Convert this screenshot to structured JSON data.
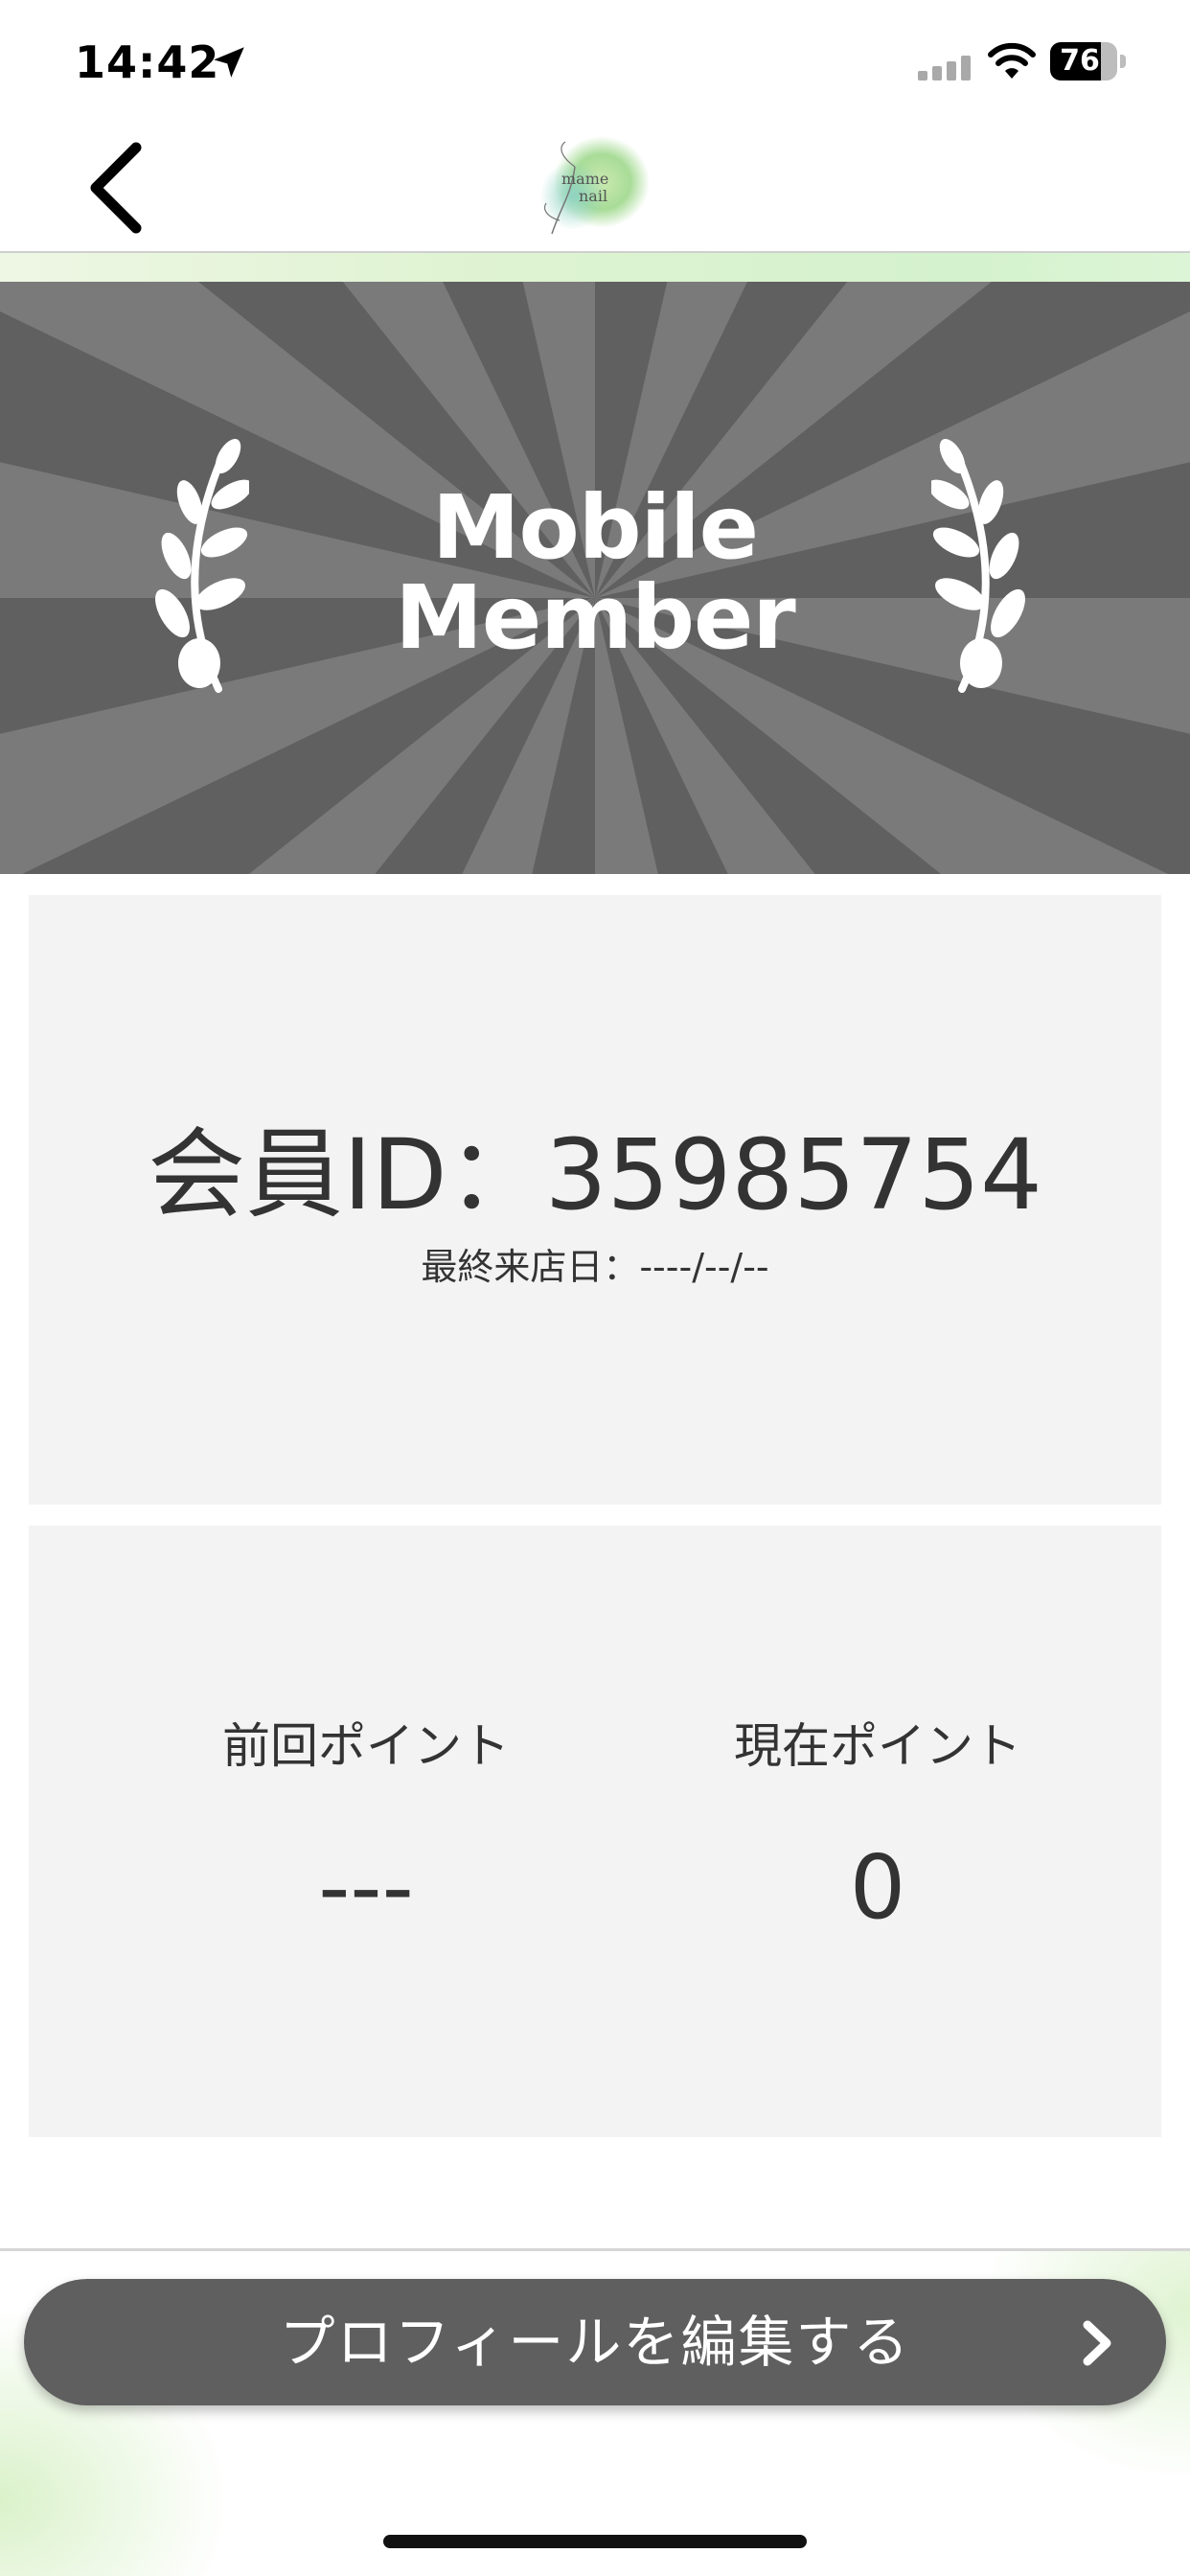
{
  "status_bar": {
    "time": "14:42",
    "battery_level": "76",
    "icons": [
      "location-arrow-icon",
      "cellular-signal-icon",
      "wifi-icon",
      "battery-icon"
    ]
  },
  "nav": {
    "back_icon": "chevron-left-icon",
    "logo_line1": "mame",
    "logo_line2": "nail"
  },
  "banner": {
    "title_line1": "Mobile",
    "title_line2": "Member",
    "icons": [
      "laurel-left-icon",
      "laurel-right-icon"
    ],
    "background_color": "#606060",
    "ray_color": "#7a7a7a"
  },
  "member_card": {
    "id_label": "会員ID：",
    "id_value": "35985754",
    "last_visit_label": "最終来店日：",
    "last_visit_value": "----/--/--"
  },
  "points": {
    "previous_label": "前回ポイント",
    "previous_value": "---",
    "current_label": "現在ポイント",
    "current_value": "0"
  },
  "actions": {
    "edit_profile_label": "プロフィールを編集する",
    "edit_profile_icon": "chevron-right-icon"
  },
  "colors": {
    "card_background": "#f3f3f3",
    "button_background": "#5f5f5f",
    "text": "#333333"
  }
}
